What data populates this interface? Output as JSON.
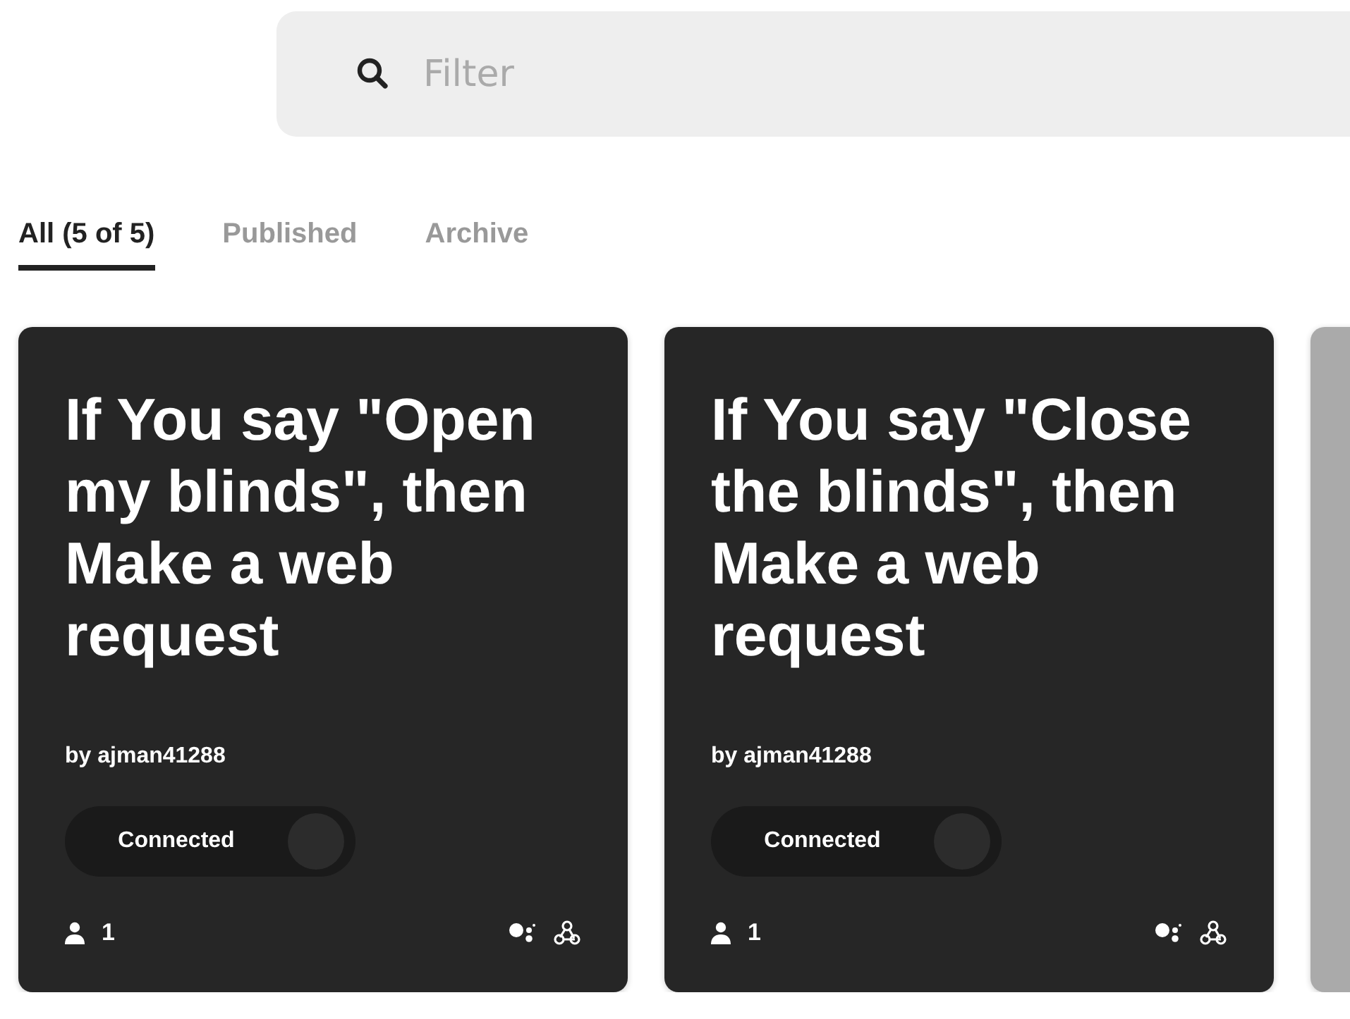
{
  "search": {
    "placeholder": "Filter"
  },
  "tabs": [
    {
      "label": "All (5 of 5)",
      "selected": true
    },
    {
      "label": "Published",
      "selected": false
    },
    {
      "label": "Archive",
      "selected": false
    }
  ],
  "cards": [
    {
      "kind": "applet",
      "title": "If You say \"Open my blinds\", then Make a web request",
      "author": "by ajman41288",
      "toggle": {
        "label": "Connected",
        "on": true
      },
      "users": "1"
    },
    {
      "kind": "applet",
      "title": "If You say \"Close the blinds\", then Make a web request",
      "author": "by ajman41288",
      "toggle": {
        "label": "Connected",
        "on": true
      },
      "users": "1"
    },
    {
      "kind": "blank"
    }
  ]
}
